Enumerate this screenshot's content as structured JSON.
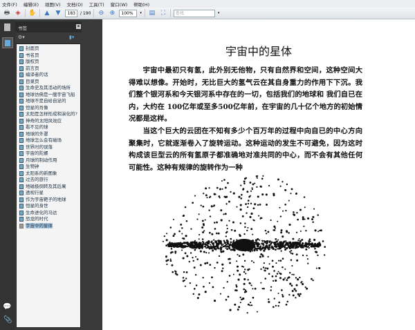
{
  "menu": [
    "文件(F)",
    "编辑(E)",
    "视图(V)",
    "文档(D)",
    "工具(T)",
    "窗口(W)",
    "帮助(H)"
  ],
  "toolbar": {
    "page_current": "183",
    "page_total": "/ 190",
    "zoom": "100%",
    "search_placeholder": "查找"
  },
  "panel": {
    "title": "书签"
  },
  "bookmarks": [
    "封面页",
    "书名页",
    "版权页",
    "前言页",
    "编译者的话",
    "目录页",
    "生命史及其活动的场所",
    "地球仿佛是一艘宇宙飞船",
    "地球不是自给自足的",
    "恒星的肖像",
    "太阳是怎样形成和演化的?",
    "神奇的太阳风效应",
    "看不见的球",
    "地球的外罩",
    "地球怎么会有磁场",
    "世界时的误落",
    "宇宙的陀螺",
    "月球的制动作用",
    "生物钟",
    "太阳系的新图象",
    "过去的旅行",
    "地磁极倒转及其后果",
    "透视行星",
    "作为宇宙靶子的地球",
    "恒星的身世",
    "生命进化的马达",
    "恐龙的时代",
    "宇宙中的星体"
  ],
  "selected_bookmark": "宇宙中的星体",
  "document": {
    "title": "宇宙中的星体",
    "paragraphs": [
      "宇宙中最初只有氢，此外别无他物，只有自然界和空间，这种空间大得难以想像。开始时，无比巨大的氢气云在其自身重力的作用下下沉。我们整个银河系和今天银河系中存在的一切，包括我们的地球和 我们自已在 内，大约在 100亿年或至多500亿年前，在宇宙的几十亿个地方的初始情况都是这样。",
      "当这个巨大的云团在不知有多少个百万年的过程中向自已的中心方向聚集时，它就逐渐卷入了旋转运动。这种运动的发生不可避免，因为这时构成该巨型云的所有氢原子都准确地对准共同的中心，而不会有其他任何可能性。这种有规律的旋转作为一种"
    ]
  }
}
